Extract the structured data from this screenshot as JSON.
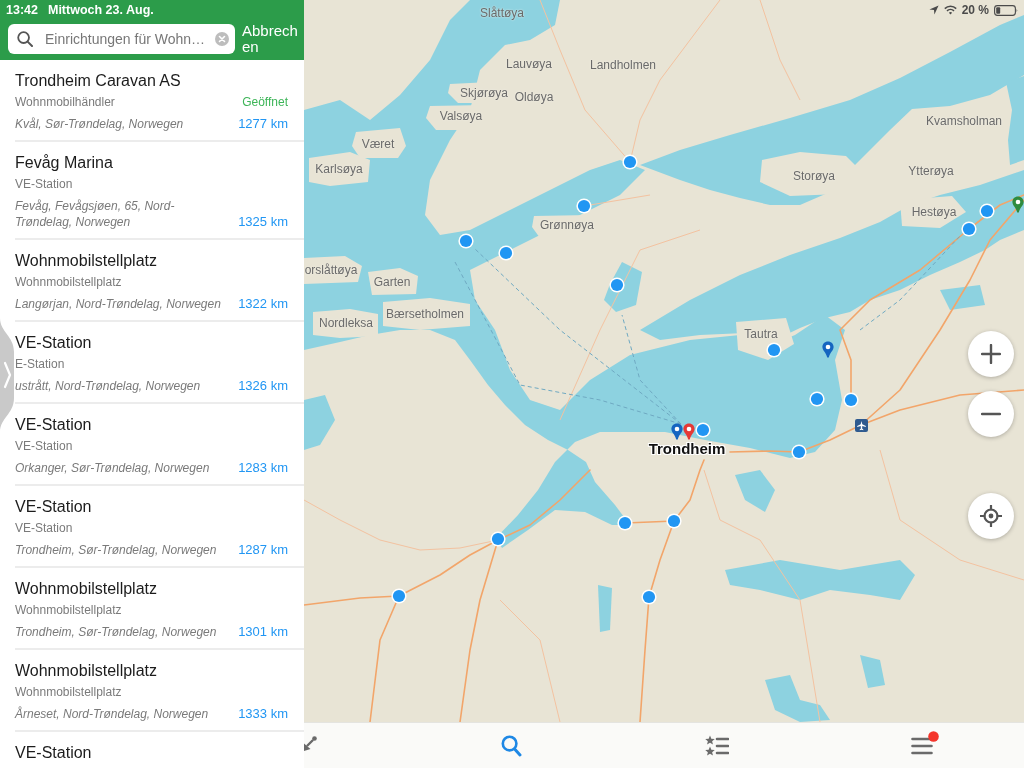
{
  "status_bar": {
    "time": "13:42",
    "date": "Mittwoch 23. Aug.",
    "battery": "20 %"
  },
  "search": {
    "value": "Einrichtungen für Wohn…",
    "cancel": "Abbrechen"
  },
  "results": [
    {
      "title": "Trondheim Caravan AS",
      "category": "Wohnmobilhändler",
      "status": "Geöffnet",
      "address": "Kvål, Sør-Trøndelag, Norwegen",
      "distance": "1277 km"
    },
    {
      "title": "Fevåg Marina",
      "category": "VE-Station",
      "address": "Fevåg, Fevågsjøen, 65, Nord-Trøndelag, Norwegen",
      "distance": "1325 km"
    },
    {
      "title": "Wohnmobilstellplatz",
      "category": "Wohnmobilstellplatz",
      "address": "Langørjan, Nord-Trøndelag, Norwegen",
      "distance": "1322 km"
    },
    {
      "title": "VE-Station",
      "category": "E-Station",
      "address": "ustrått, Nord-Trøndelag, Norwegen",
      "distance": "1326 km"
    },
    {
      "title": "VE-Station",
      "category": "VE-Station",
      "address": "Orkanger, Sør-Trøndelag, Norwegen",
      "distance": "1283 km"
    },
    {
      "title": "VE-Station",
      "category": "VE-Station",
      "address": "Trondheim, Sør-Trøndelag, Norwegen",
      "distance": "1287 km"
    },
    {
      "title": "Wohnmobilstellplatz",
      "category": "Wohnmobilstellplatz",
      "address": "Trondheim, Sør-Trøndelag, Norwegen",
      "distance": "1301 km"
    },
    {
      "title": "Wohnmobilstellplatz",
      "category": "Wohnmobilstellplatz",
      "address": "Årneset, Nord-Trøndelag, Norwegen",
      "distance": "1333 km"
    },
    {
      "title": "VE-Station"
    }
  ],
  "map": {
    "labels": [
      {
        "text": "Slåttøya",
        "kind": "place"
      },
      {
        "text": "Lauvøya",
        "kind": "place"
      },
      {
        "text": "Landholmen",
        "kind": "place"
      },
      {
        "text": "Skjørøya",
        "kind": "place"
      },
      {
        "text": "Oldøya",
        "kind": "place"
      },
      {
        "text": "Valsøya",
        "kind": "place"
      },
      {
        "text": "Kvamsholman",
        "kind": "place"
      },
      {
        "text": "Været",
        "kind": "place"
      },
      {
        "text": "Karlsøya",
        "kind": "place"
      },
      {
        "text": "Ytterøya",
        "kind": "place"
      },
      {
        "text": "Storøya",
        "kind": "place"
      },
      {
        "text": "Hestøya",
        "kind": "place"
      },
      {
        "text": "Grønnøya",
        "kind": "place"
      },
      {
        "text": "orslåttøya",
        "kind": "place"
      },
      {
        "text": "Garten",
        "kind": "place"
      },
      {
        "text": "Bærsetholmen",
        "kind": "place"
      },
      {
        "text": "Nordleksa",
        "kind": "place"
      },
      {
        "text": "Tautra",
        "kind": "place"
      },
      {
        "text": "Trondheim",
        "kind": "city"
      }
    ],
    "markers": [
      {
        "kind": "dot",
        "color": "#2196f3"
      },
      {
        "kind": "pin",
        "color": "#2e8b3e"
      },
      {
        "kind": "dot",
        "color": "#2196f3"
      },
      {
        "kind": "dot",
        "color": "#2196f3"
      },
      {
        "kind": "dot",
        "color": "#2196f3"
      },
      {
        "kind": "dot",
        "color": "#2196f3"
      },
      {
        "kind": "dot",
        "color": "#2196f3"
      },
      {
        "kind": "dot",
        "color": "#2196f3"
      },
      {
        "kind": "pin",
        "color": "#1565c0"
      },
      {
        "kind": "dot",
        "color": "#2196f3"
      },
      {
        "kind": "dot",
        "color": "#2196f3"
      },
      {
        "kind": "dot",
        "color": "#2196f3"
      },
      {
        "kind": "airport",
        "color": "#2f5a8f"
      },
      {
        "kind": "pin",
        "color": "#e53935"
      },
      {
        "kind": "pin",
        "color": "#1565c0"
      },
      {
        "kind": "dot",
        "color": "#2196f3"
      },
      {
        "kind": "dot",
        "color": "#2196f3"
      },
      {
        "kind": "dot",
        "color": "#2196f3"
      },
      {
        "kind": "dot",
        "color": "#2196f3"
      },
      {
        "kind": "dot",
        "color": "#2196f3"
      },
      {
        "kind": "dot",
        "color": "#2196f3"
      },
      {
        "kind": "dot",
        "color": "#2196f3"
      }
    ]
  },
  "tab_bar": {
    "tabs": [
      {
        "kind": "arrow",
        "selected": false,
        "badge": false
      },
      {
        "kind": "search",
        "selected": true,
        "badge": false
      },
      {
        "kind": "bookmarks",
        "selected": false,
        "badge": false
      },
      {
        "kind": "menu",
        "selected": false,
        "badge": true
      }
    ]
  }
}
